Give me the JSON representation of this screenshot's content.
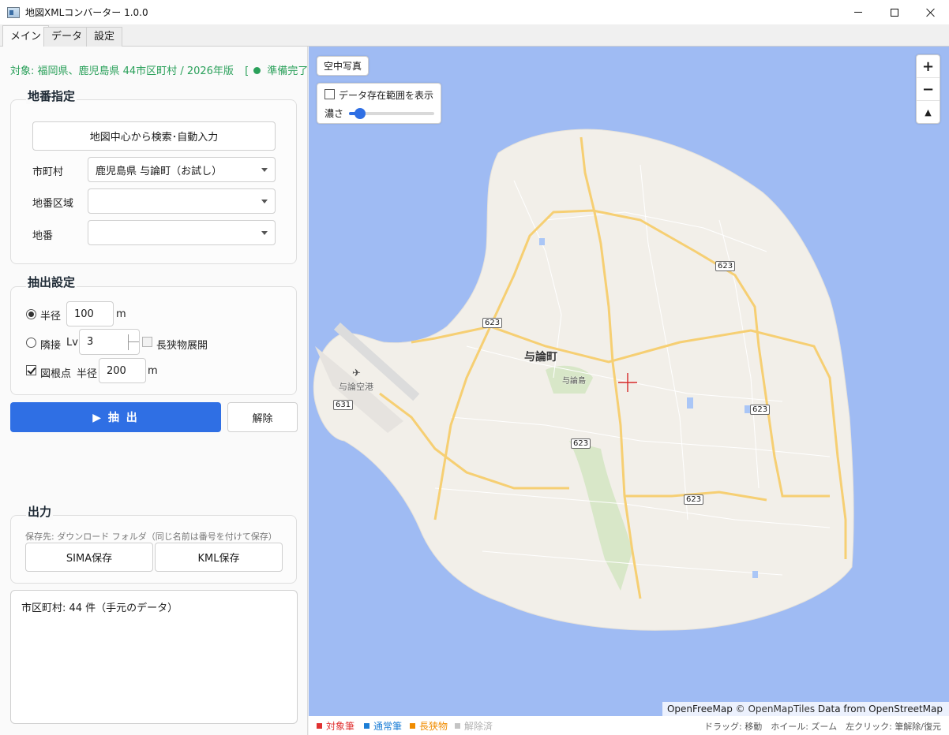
{
  "window": {
    "title": "地図XMLコンバーター 1.0.0",
    "controls": [
      "minimize-icon",
      "maximize-icon",
      "close-icon"
    ]
  },
  "tabs": [
    {
      "label": "メイン",
      "active": true
    },
    {
      "label": "データ",
      "active": false
    },
    {
      "label": "設定",
      "active": false
    }
  ],
  "status": {
    "target": "対象: 福岡県、鹿児島県 44市区町村 / 2026年版",
    "bracket": "[",
    "ready": "準備完了",
    "color": "#2aa05a"
  },
  "parcel": {
    "title": "地番指定",
    "search_button": "地図中心から検索･自動入力",
    "city_label": "市町村",
    "city_value": "鹿児島県 与論町（お試し）",
    "area_label": "地番区域",
    "area_value": "",
    "lot_label": "地番",
    "lot_value": ""
  },
  "extract": {
    "title": "抽出設定",
    "radius_label": "半径",
    "radius_value": "100",
    "radius_unit": "m",
    "radius_checked": true,
    "adjacent_label": "隣接",
    "level_label": "Lv",
    "level_value": "3",
    "adjacent_checked": false,
    "long_label": "長狭物展開",
    "long_checked": false,
    "benchmark_label": "図根点",
    "benchmark_checked": true,
    "bm_radius_label": "半径",
    "bm_radius_value": "200",
    "bm_radius_unit": "m",
    "extract_button": "▶ 抽 出",
    "clear_button": "解除",
    "primary_color": "#2f6fe4"
  },
  "output": {
    "title": "出力",
    "hint": "保存先: ダウンロード フォルダ（同じ名前は番号を付けて保存）",
    "sima_button": "SIMA保存",
    "kml_button": "KML保存"
  },
  "log": {
    "text": "市区町村: 44 件（手元のデータ）"
  },
  "map": {
    "aerial_button": "空中写真",
    "coverage_label": "データ存在範囲を表示",
    "coverage_checked": false,
    "opacity_label": "濃さ",
    "opacity_value": 0.1,
    "zoom_in": "+",
    "zoom_out": "−",
    "compass": "▲",
    "town_label": "与論町",
    "island_label": "与論島",
    "airport_label": "与論空港",
    "routes": [
      "623",
      "623",
      "623",
      "623",
      "623",
      "623",
      "631"
    ],
    "attribution_a": "OpenFreeMap",
    "attribution_b": "© OpenMapTiles",
    "attribution_c": "Data from",
    "attribution_d": "OpenStreetMap",
    "sea_color": "#9fbbf3",
    "land_color": "#f2efe9"
  },
  "legend": [
    {
      "label": "対象筆",
      "color": "#e03131"
    },
    {
      "label": "通常筆",
      "color": "#1c7ed6"
    },
    {
      "label": "長狭物",
      "color": "#f08c00"
    },
    {
      "label": "解除済",
      "color": "#b0b0b0"
    }
  ],
  "help": "ドラッグ: 移動　ホイール: ズーム　左クリック: 筆解除/復元"
}
